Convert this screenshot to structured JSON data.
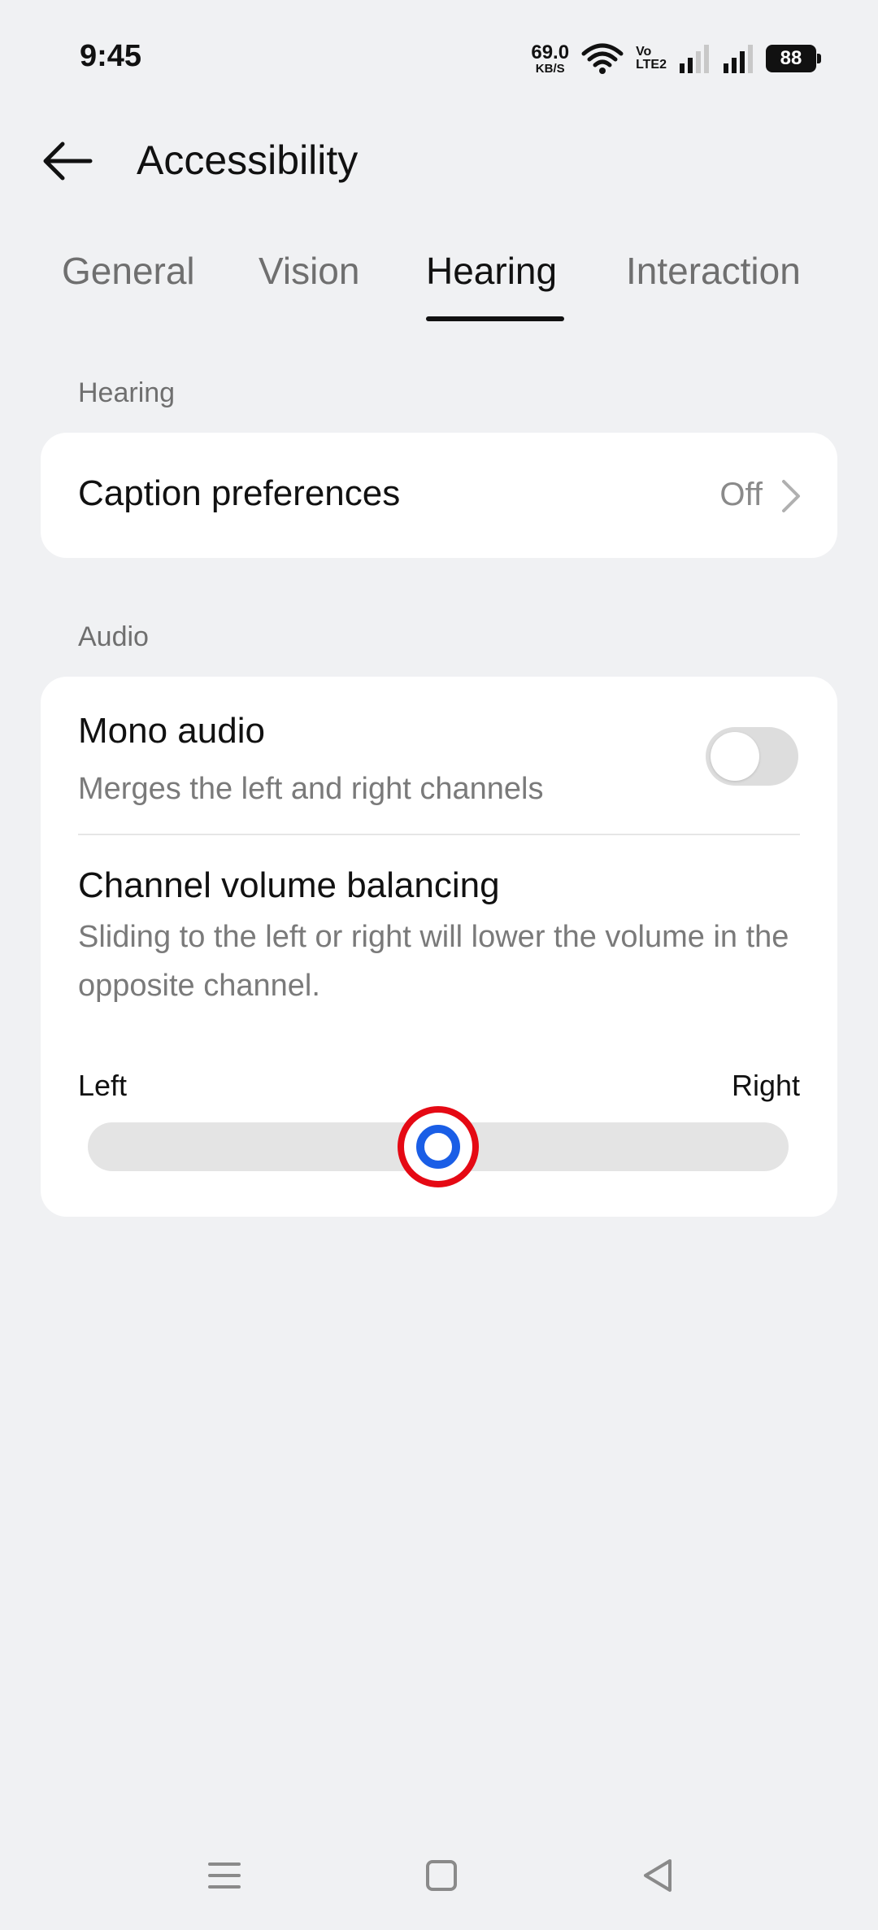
{
  "status_bar": {
    "time": "9:45",
    "net_speed_value": "69.0",
    "net_speed_unit": "KB/S",
    "volte_top": "Vo",
    "volte_bottom": "LTE2",
    "battery": "88"
  },
  "header": {
    "back_icon": "arrow-left-icon",
    "title": "Accessibility"
  },
  "tabs": [
    {
      "label": "General",
      "active": false
    },
    {
      "label": "Vision",
      "active": false
    },
    {
      "label": "Hearing",
      "active": true
    },
    {
      "label": "Interaction",
      "active": false
    }
  ],
  "hearing_section": {
    "label": "Hearing",
    "caption_preferences": {
      "title": "Caption preferences",
      "value": "Off"
    }
  },
  "audio_section": {
    "label": "Audio",
    "mono_audio": {
      "title": "Mono audio",
      "description": "Merges the left and right channels",
      "enabled": false
    },
    "channel_balance": {
      "title": "Channel volume balancing",
      "description": "Sliding to the left or right will lower the volume in the opposite channel.",
      "left_label": "Left",
      "right_label": "Right",
      "position": 0.5
    }
  },
  "colors": {
    "background": "#f0f1f3",
    "card": "#ffffff",
    "accent": "#1a5ee6",
    "highlight_ring": "#e50914"
  },
  "nav_bar": {
    "icons": [
      "menu-icon",
      "home-square-icon",
      "back-triangle-icon"
    ]
  }
}
